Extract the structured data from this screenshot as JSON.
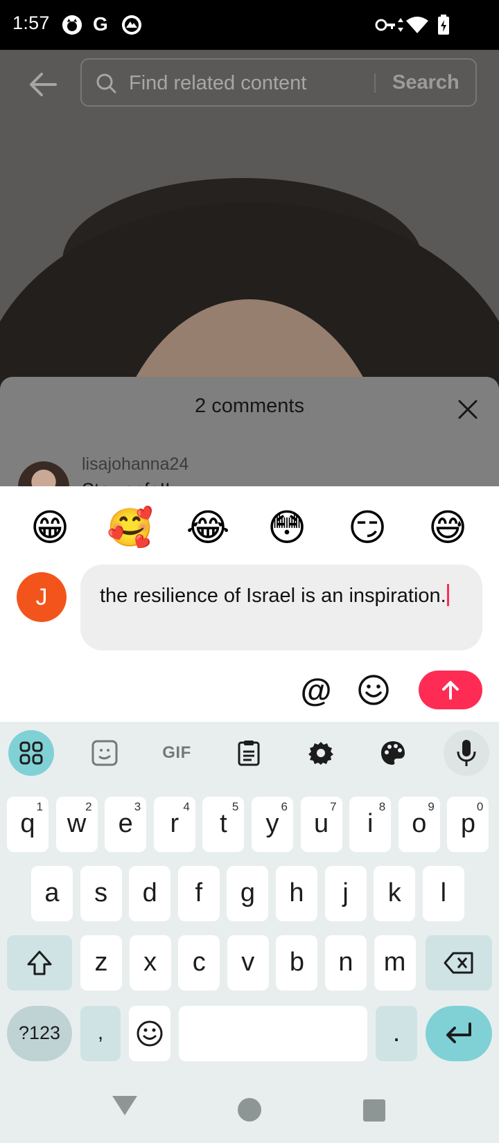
{
  "status_bar": {
    "time": "1:57",
    "g_label": "G"
  },
  "search": {
    "placeholder": "Find related content",
    "button": "Search"
  },
  "comments_sheet": {
    "title": "2 comments",
    "first_comment": {
      "username": "lisajohanna24",
      "text": "Stay safe!! ..."
    }
  },
  "composer": {
    "emojis": [
      "😁",
      "🥰",
      "😂",
      "😳",
      "😏",
      "😅"
    ],
    "avatar_initial": "J",
    "input_text": "the resilience of Israel is an inspiration.",
    "mention_label": "@"
  },
  "keyboard": {
    "toolbar": {
      "gif_label": "GIF"
    },
    "row1": [
      {
        "k": "q",
        "h": "1"
      },
      {
        "k": "w",
        "h": "2"
      },
      {
        "k": "e",
        "h": "3"
      },
      {
        "k": "r",
        "h": "4"
      },
      {
        "k": "t",
        "h": "5"
      },
      {
        "k": "y",
        "h": "6"
      },
      {
        "k": "u",
        "h": "7"
      },
      {
        "k": "i",
        "h": "8"
      },
      {
        "k": "o",
        "h": "9"
      },
      {
        "k": "p",
        "h": "0"
      }
    ],
    "row2": [
      "a",
      "s",
      "d",
      "f",
      "g",
      "h",
      "j",
      "k",
      "l"
    ],
    "row3": [
      "z",
      "x",
      "c",
      "v",
      "b",
      "n",
      "m"
    ],
    "symbols_label": "?123",
    "comma_label": ",",
    "period_label": "."
  },
  "colors": {
    "accent": "#fe2c55",
    "avatar": "#f2541b",
    "keyboard_accent": "#7fd1d6"
  }
}
